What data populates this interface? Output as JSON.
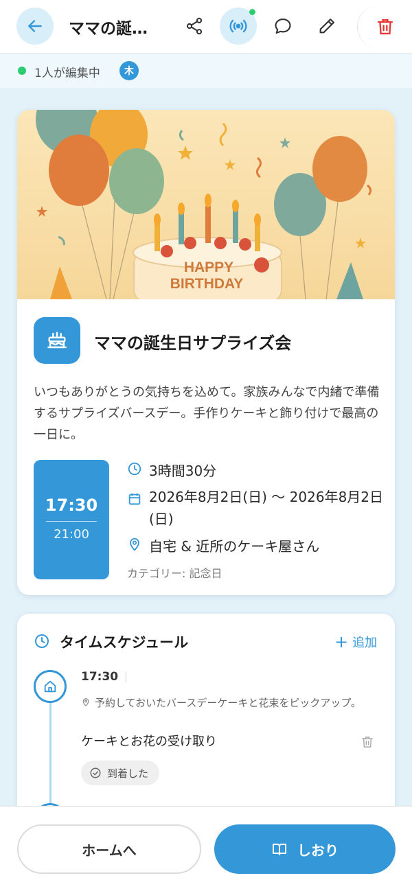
{
  "header": {
    "title": "ママの誕…",
    "icons": {
      "back": "arrow-left-icon",
      "share": "share-icon",
      "live": "broadcast-icon",
      "comment": "chat-bubble-icon",
      "edit": "pencil-icon",
      "delete": "trash-icon"
    }
  },
  "collab": {
    "status_text": "1人が編集中",
    "avatar_initial": "木"
  },
  "event": {
    "title": "ママの誕生日サプライズ会",
    "description": "いつもありがとうの気持ちを込めて。家族みんなで内緒で準備するサプライズバースデー。手作りケーキと飾り付けで最高の一日に。",
    "hero_text_line1": "HAPPY",
    "hero_text_line2": "BIRTHDAY",
    "start_time": "17:30",
    "end_time": "21:00",
    "duration": "3時間30分",
    "date_range": "2026年8月2日(日) 〜 2026年8月2日(日)",
    "location": "自宅 & 近所のケーキ屋さん",
    "category": "カテゴリー: 記念日"
  },
  "schedule": {
    "title": "タイムスケジュール",
    "add_label": "追加",
    "items": [
      {
        "time": "17:30",
        "note": "予約しておいたバースデーケーキと花束をピックアップ。",
        "name": "ケーキとお花の受け取り",
        "status_label": "到着した"
      }
    ]
  },
  "footer": {
    "home_label": "ホームへ",
    "guide_label": "しおり"
  },
  "colors": {
    "accent": "#3498d8",
    "accent_light": "#d8eef9",
    "live_dot": "#2ecc71",
    "delete": "#e53935"
  }
}
